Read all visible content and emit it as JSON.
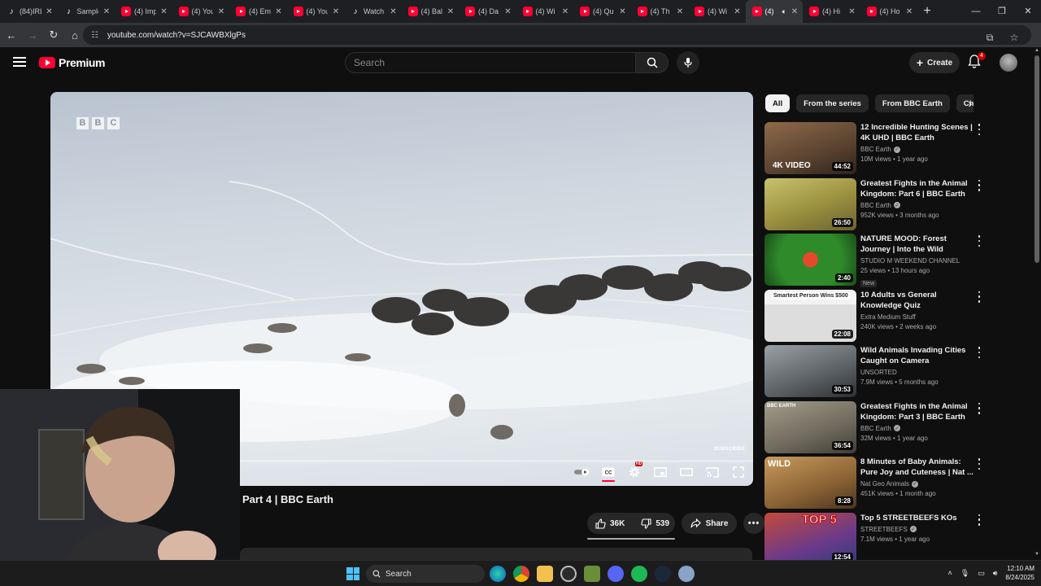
{
  "browser": {
    "tabs": [
      {
        "label": "(84)IRL",
        "type": "tk"
      },
      {
        "label": "Sample",
        "type": "tk"
      },
      {
        "label": "(4) Imp",
        "type": "yt"
      },
      {
        "label": "(4) You",
        "type": "yt"
      },
      {
        "label": "(4) Em",
        "type": "yt"
      },
      {
        "label": "(4) You",
        "type": "yt"
      },
      {
        "label": "Watch",
        "type": "tk"
      },
      {
        "label": "(4) Bal",
        "type": "yt"
      },
      {
        "label": "(4) Da",
        "type": "yt"
      },
      {
        "label": "(4) Wi",
        "type": "yt"
      },
      {
        "label": "(4) Qu",
        "type": "yt"
      },
      {
        "label": "(4) Th",
        "type": "yt"
      },
      {
        "label": "(4) Wi",
        "type": "yt"
      },
      {
        "label": "(4)",
        "type": "yt",
        "active": true
      },
      {
        "label": "(4) Hi",
        "type": "yt"
      },
      {
        "label": "(4) Ho",
        "type": "yt"
      }
    ],
    "new_tab": "+",
    "url": "youtube.com/watch?v=SJCAWBXlgPs"
  },
  "youtube": {
    "logo_text": "Premium",
    "search_placeholder": "Search",
    "create_label": "Create",
    "notification_count": "4"
  },
  "player": {
    "watermark_letters": [
      "B",
      "B",
      "C"
    ],
    "subscribe_watermark": "SUBSCRIBE",
    "progress": 0.0
  },
  "video": {
    "title_fragment": "Part 4 | BBC Earth",
    "likes": "36K",
    "dislikes": "539",
    "share_label": "Share"
  },
  "chips": [
    "All",
    "From the series",
    "From BBC Earth",
    "Cheetahs"
  ],
  "recommendations": [
    {
      "title": "12 Incredible Hunting Scenes | 4K UHD | BBC Earth",
      "channel": "BBC Earth",
      "verified": true,
      "stats": "10M views • 1 year ago",
      "duration": "44:52",
      "tag": "4K VIDEO"
    },
    {
      "title": "Greatest Fights in the Animal Kingdom: Part 6 | BBC Earth",
      "channel": "BBC Earth",
      "verified": true,
      "stats": "952K views • 3 months ago",
      "duration": "26:50",
      "tag": ""
    },
    {
      "title": "NATURE MOOD: Forest Journey | Into the Wild",
      "channel": "STUDIO M WEEKEND CHANNEL",
      "verified": false,
      "stats": "25 views • 13 hours ago",
      "duration": "2:40",
      "tag": "",
      "badge": "New"
    },
    {
      "title": "10 Adults vs General Knowledge Quiz",
      "channel": "Extra Medium Stuff",
      "verified": false,
      "stats": "240K views • 2 weeks ago",
      "duration": "22:08",
      "tag": "Smartest Person Wins $500"
    },
    {
      "title": "Wild Animals Invading Cities Caught on Camera",
      "channel": "UNSORTED",
      "verified": false,
      "stats": "7.9M views • 5 months ago",
      "duration": "30:53",
      "tag": ""
    },
    {
      "title": "Greatest Fights in the Animal Kingdom: Part 3 | BBC Earth",
      "channel": "BBC Earth",
      "verified": true,
      "stats": "32M views • 1 year ago",
      "duration": "36:54",
      "tag": "BBC EARTH"
    },
    {
      "title": "8 Minutes of Baby Animals: Pure Joy and Cuteness | Nat ...",
      "channel": "Nat Geo Animals",
      "verified": true,
      "stats": "451K views • 1 month ago",
      "duration": "8:28",
      "tag": "WILD"
    },
    {
      "title": "Top 5 STREETBEEFS KOs",
      "channel": "STREETBEEFS",
      "verified": true,
      "stats": "7.1M views • 1 year ago",
      "duration": "12:54",
      "tag": "TOP 5"
    }
  ],
  "taskbar": {
    "search_label": "Search",
    "time": "12:10 AM",
    "date": "8/24/2025"
  },
  "colors": {
    "youtube_red": "#ff0033",
    "page_bg": "#0f0f0f",
    "chip_bg": "#272727"
  }
}
